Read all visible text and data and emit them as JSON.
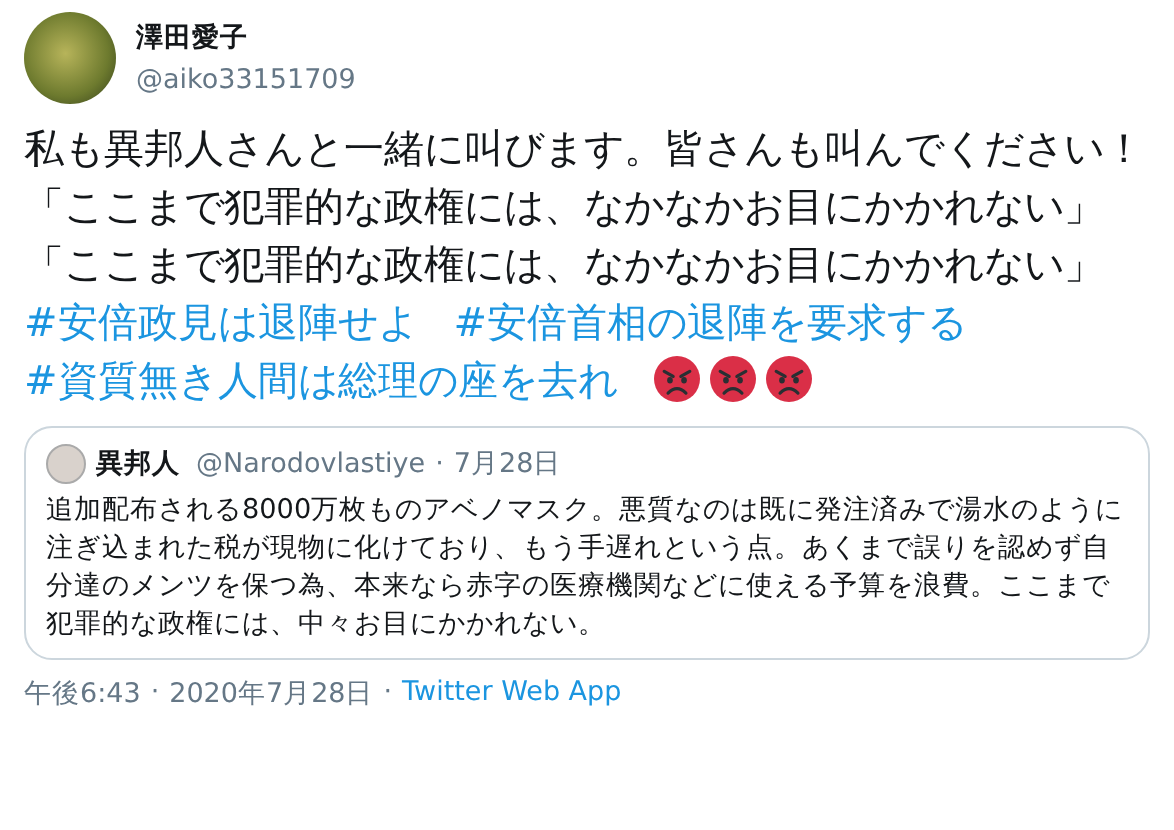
{
  "author": {
    "name": "澤田愛子",
    "handle": "@aiko33151709"
  },
  "tweet": {
    "segments": [
      {
        "kind": "text",
        "text": "私も異邦人さんと一緒に叫びます。皆さんも叫んでください！「ここまで犯罪的な政権には、なかなかお目にかかれない」「ここまで犯罪的な政権には、なかなかお目にかかれない」"
      },
      {
        "kind": "hashtag",
        "text": "#安倍政見は退陣せよ"
      },
      {
        "kind": "hashtag",
        "text": "#安倍首相の退陣を要求する"
      },
      {
        "kind": "hashtag",
        "text": "#資質無き人間は総理の座を去れ"
      }
    ],
    "emojis": [
      {
        "kind": "angry"
      },
      {
        "kind": "angry"
      },
      {
        "kind": "angry"
      }
    ]
  },
  "quote": {
    "name": "異邦人",
    "handle": "@Narodovlastiye",
    "separator": "·",
    "date": "7月28日",
    "text": "追加配布される8000万枚ものアベノマスク。悪質なのは既に発注済みで湯水のように注ぎ込まれた税が現物に化けており、もう手遅れという点。あくまで誤りを認めず自分達のメンツを保つ為、本来なら赤字の医療機関などに使える予算を浪費。ここまで犯罪的な政権には、中々お目にかかれない。"
  },
  "footer": {
    "time": "午後6:43",
    "separator_1": "·",
    "date": "2020年7月28日",
    "separator_2": "·",
    "source": "Twitter Web App"
  }
}
